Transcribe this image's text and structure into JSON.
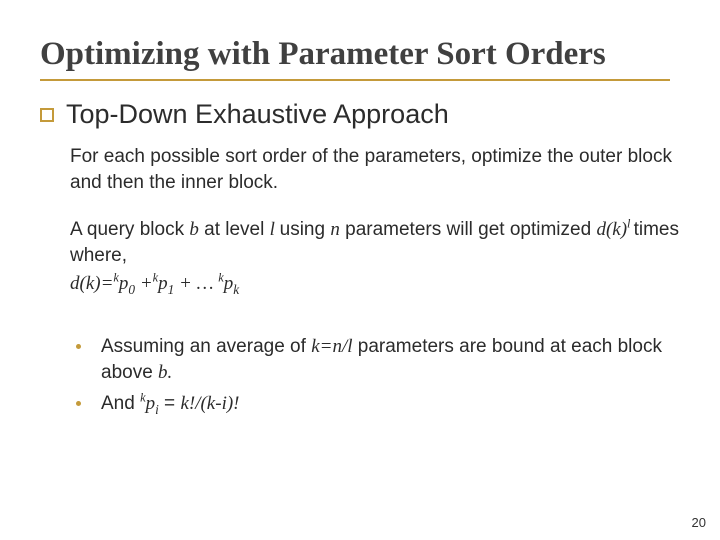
{
  "title": "Optimizing with Parameter Sort Orders",
  "main_heading": "Top-Down Exhaustive Approach",
  "para1": "For each possible sort order of the parameters, optimize the outer block and then the inner block.",
  "para2_pre": "A query block ",
  "sym_b": "b",
  "para2_mid1": " at level ",
  "sym_l": "l ",
  "para2_mid2": "using ",
  "sym_n": "n",
  "para2_mid3": " parameters will get optimized ",
  "sym_dk": "d(k)",
  "para2_post": " times where,",
  "eq_lhs": "d(k)=",
  "eq_k1": "k",
  "eq_p0": "p",
  "eq_sub0": "0",
  "eq_plus1": " +",
  "eq_k2": "k",
  "eq_p1": "p",
  "eq_sub1": "1",
  "eq_plus2": " + … ",
  "eq_k3": "k",
  "eq_pk": "p",
  "eq_subk": "k",
  "b1_a": "Assuming an average of ",
  "b1_knl": "k=n/l",
  "b1_b": " parameters are bound at each block above ",
  "b1_bvar": "b.",
  "b2_a": "And ",
  "b2_k": "k",
  "b2_p": "p",
  "b2_i": "i",
  "b2_eq": " = ",
  "b2_rhs": "k!/(k-i)!",
  "pagenum": "20"
}
